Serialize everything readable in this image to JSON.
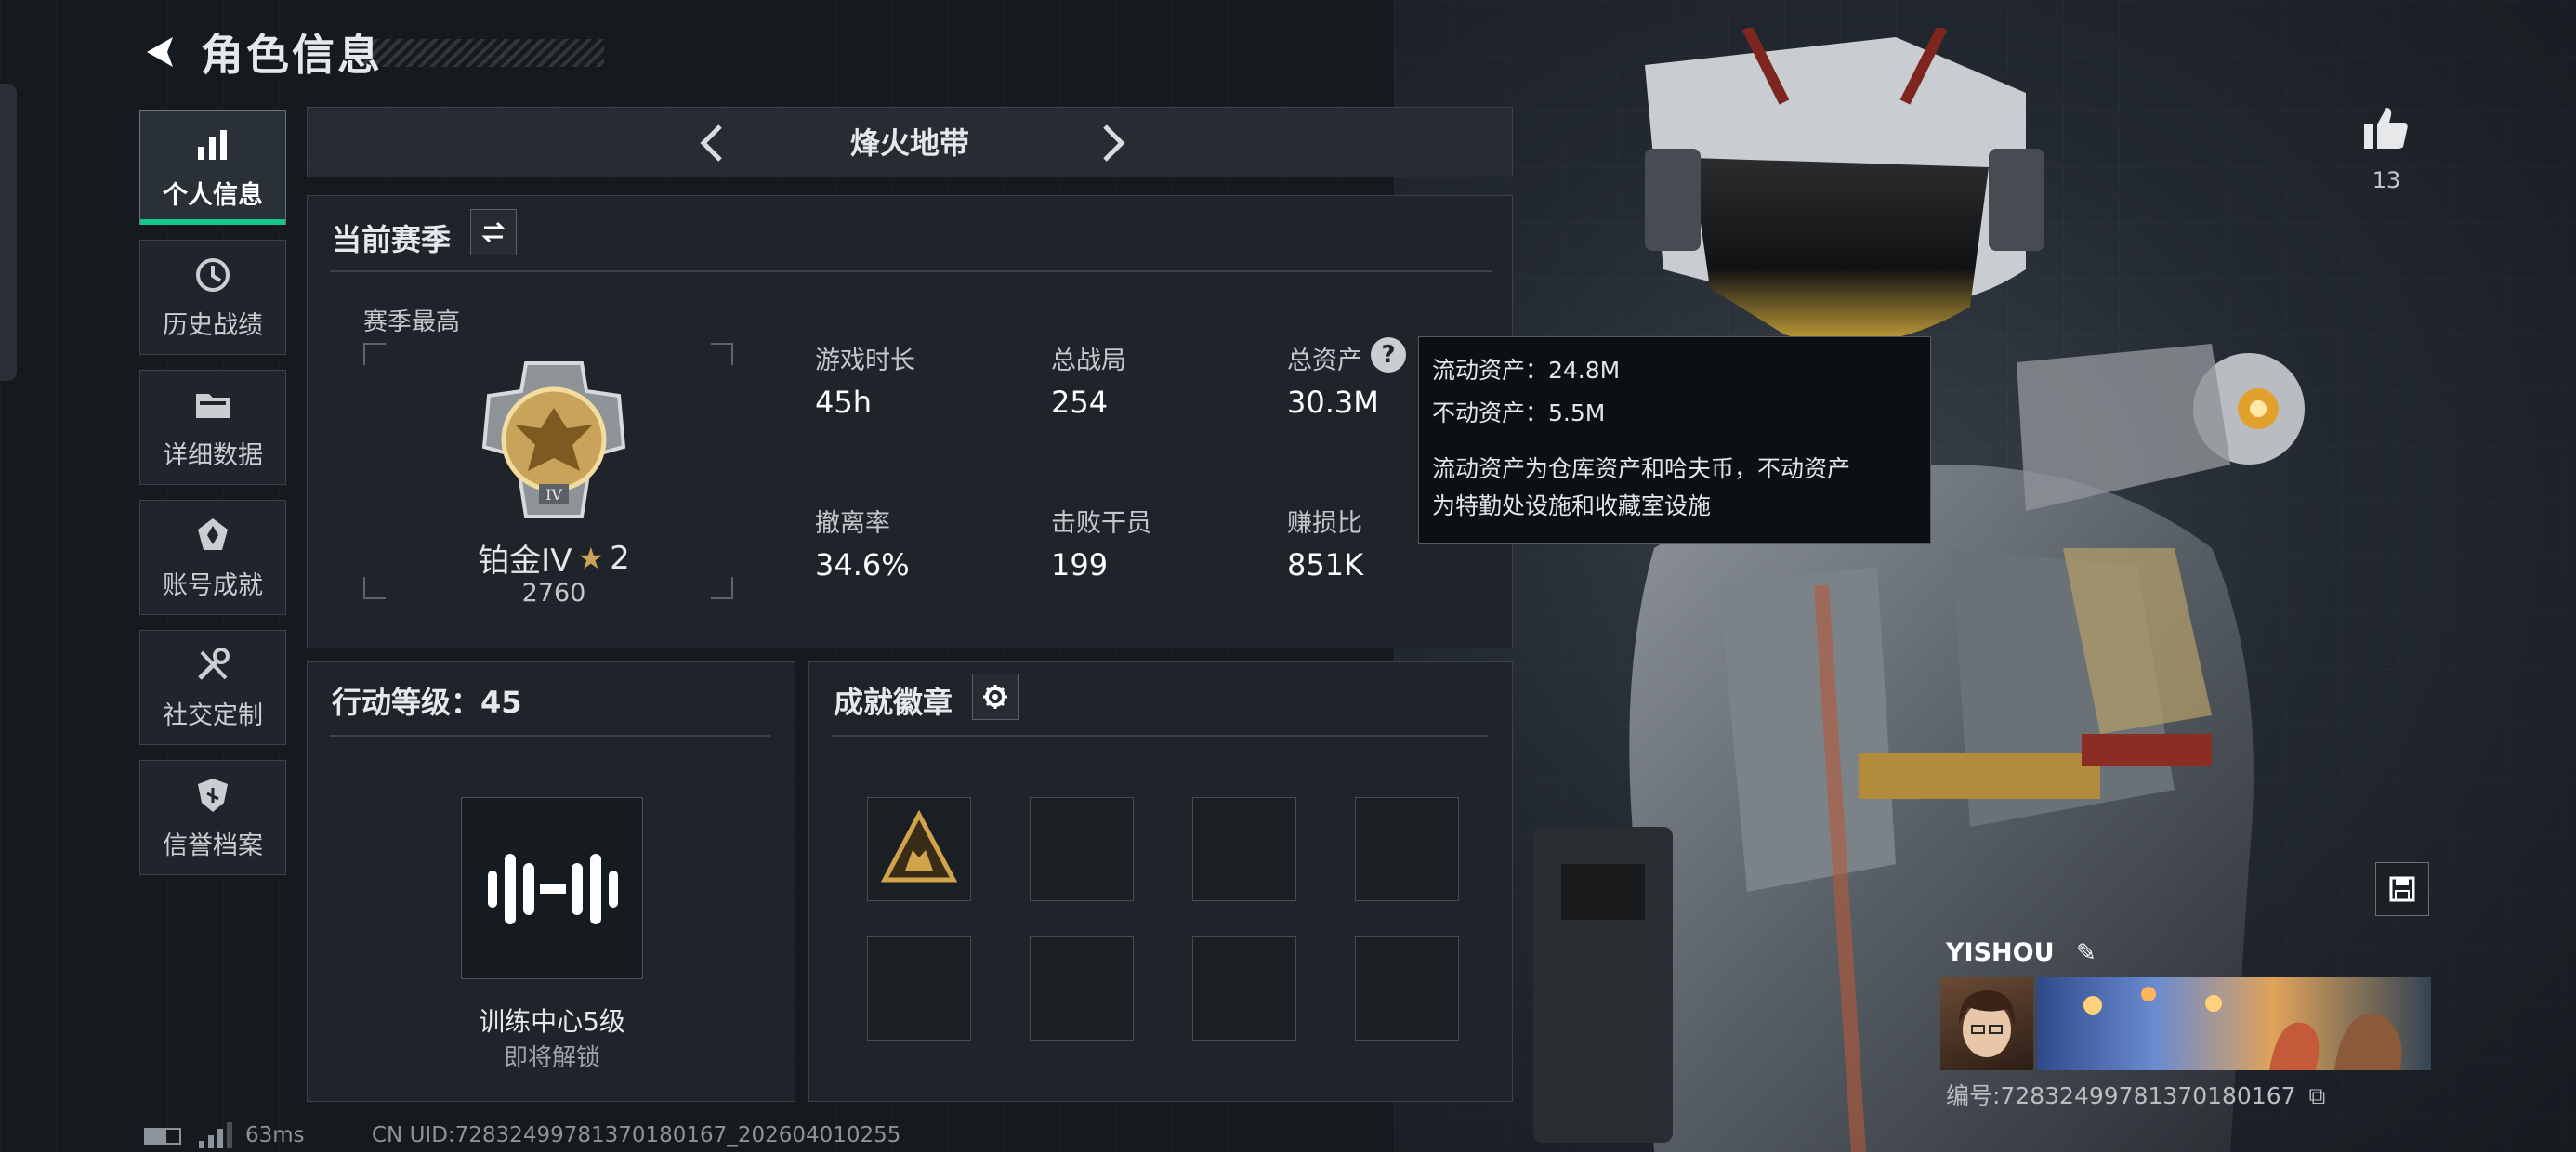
{
  "header": {
    "title": "角色信息"
  },
  "nav": [
    {
      "label": "个人信息",
      "icon": "bar-chart-icon",
      "active": true
    },
    {
      "label": "历史战绩",
      "icon": "history-clock-icon",
      "active": false
    },
    {
      "label": "详细数据",
      "icon": "folder-icon",
      "active": false
    },
    {
      "label": "账号成就",
      "icon": "achievement-icon",
      "active": false
    },
    {
      "label": "社交定制",
      "icon": "tools-icon",
      "active": false
    },
    {
      "label": "信誉档案",
      "icon": "shield-icon",
      "active": false
    }
  ],
  "mode": {
    "name": "烽火地带"
  },
  "season": {
    "title": "当前赛季",
    "best_label": "赛季最高",
    "rank_name": "铂金IV",
    "rank_stars": "2",
    "rank_score": "2760",
    "stats": [
      {
        "label": "游戏时长",
        "value": "45h"
      },
      {
        "label": "总战局",
        "value": "254"
      },
      {
        "label": "总资产",
        "value": "30.3M"
      },
      {
        "label": "撤离率",
        "value": "34.6%"
      },
      {
        "label": "击败干员",
        "value": "199"
      },
      {
        "label": "赚损比",
        "value": "851K"
      }
    ]
  },
  "tooltip": {
    "liquid": "流动资产：24.8M",
    "fixed": "不动资产：5.5M",
    "desc_line1": "流动资产为仓库资产和哈夫币，不动资产",
    "desc_line2": "为特勤处设施和收藏室设施"
  },
  "level": {
    "title": "行动等级：45",
    "unlock_name": "训练中心5级",
    "unlock_status": "即将解锁"
  },
  "achievements": {
    "title": "成就徽章"
  },
  "likes": {
    "count": "13"
  },
  "player": {
    "name": "YISHOU",
    "id": "编号:72832499781370180167"
  },
  "footer": {
    "ping": "63ms",
    "uid": "CN UID:72832499781370180167_202604010255"
  },
  "colors": {
    "accent": "#13c58a",
    "panel": "#1e2429",
    "border": "#3c4249",
    "rank_gold": "#c9a35a"
  }
}
